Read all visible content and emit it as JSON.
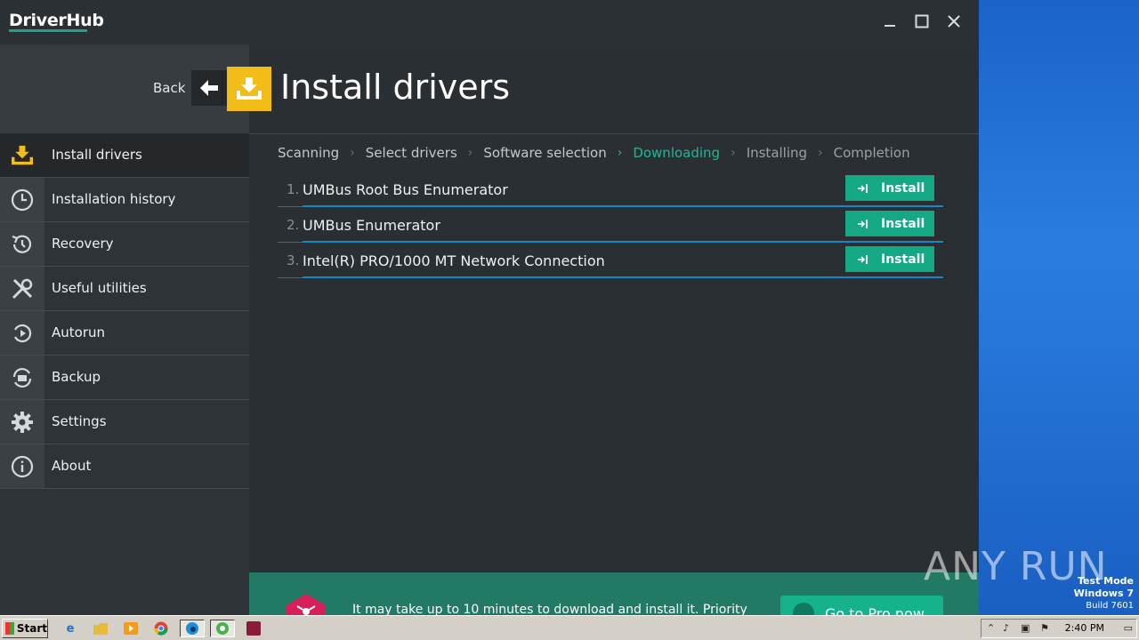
{
  "app": {
    "logo": "DriverHub",
    "window_controls": {
      "minimize": "—",
      "maximize": "☐",
      "close": "✕"
    }
  },
  "header": {
    "back_label": "Back",
    "title": "Install drivers"
  },
  "sidebar": {
    "items": [
      {
        "label": "Install drivers",
        "icon": "download-tray-icon",
        "active": true
      },
      {
        "label": "Installation history",
        "icon": "clock-icon"
      },
      {
        "label": "Recovery",
        "icon": "history-icon"
      },
      {
        "label": "Useful utilities",
        "icon": "tools-icon"
      },
      {
        "label": "Autorun",
        "icon": "autorun-icon"
      },
      {
        "label": "Backup",
        "icon": "backup-icon"
      },
      {
        "label": "Settings",
        "icon": "gear-icon"
      },
      {
        "label": "About",
        "icon": "info-icon"
      }
    ]
  },
  "steps": {
    "items": [
      {
        "label": "Scanning"
      },
      {
        "label": "Select drivers"
      },
      {
        "label": "Software selection"
      },
      {
        "label": "Downloading",
        "active": true
      },
      {
        "label": "Installing"
      },
      {
        "label": "Completion"
      }
    ]
  },
  "drivers": {
    "items": [
      {
        "num": "1.",
        "name": "UMBus Root Bus Enumerator",
        "button": "Install"
      },
      {
        "num": "2.",
        "name": "UMBus Enumerator",
        "button": "Install"
      },
      {
        "num": "3.",
        "name": "Intel(R) PRO/1000 MT Network Connection",
        "button": "Install"
      }
    ]
  },
  "banner": {
    "text": "It may take up to 10 minutes to download and install it. Priority",
    "button": "Go to Pro now"
  },
  "desktop": {
    "watermark": "ANY RUN",
    "test_mode": "Test Mode",
    "os": "Windows 7",
    "build": "Build 7601"
  },
  "taskbar": {
    "start": "Start",
    "clock": "2:40 PM"
  },
  "colors": {
    "accent": "#14a884",
    "active_step": "#1fb894",
    "header_icon": "#f2bd18",
    "row_line": "#1586c4"
  }
}
